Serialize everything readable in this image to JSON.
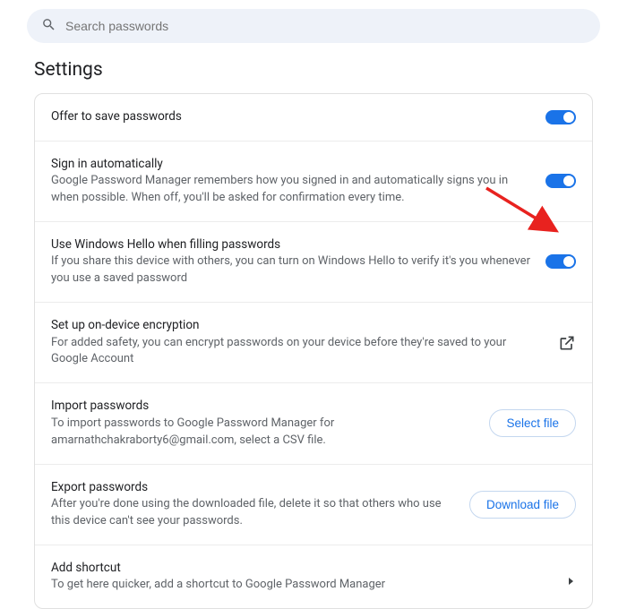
{
  "search": {
    "placeholder": "Search passwords"
  },
  "page_title": "Settings",
  "rows": {
    "offer_save": {
      "title": "Offer to save passwords"
    },
    "auto_signin": {
      "title": "Sign in automatically",
      "desc": "Google Password Manager remembers how you signed in and automatically signs you in when possible. When off, you'll be asked for confirmation every time."
    },
    "windows_hello": {
      "title": "Use Windows Hello when filling passwords",
      "desc": "If you share this device with others, you can turn on Windows Hello to verify it's you whenever you use a saved password"
    },
    "encryption": {
      "title": "Set up on-device encryption",
      "desc": "For added safety, you can encrypt passwords on your device before they're saved to your Google Account"
    },
    "import": {
      "title": "Import passwords",
      "desc": "To import passwords to Google Password Manager for amarnathchakraborty6@gmail.com, select a CSV file.",
      "button": "Select file"
    },
    "export": {
      "title": "Export passwords",
      "desc": "After you're done using the downloaded file, delete it so that others who use this device can't see your passwords.",
      "button": "Download file"
    },
    "shortcut": {
      "title": "Add shortcut",
      "desc": "To get here quicker, add a shortcut to Google Password Manager"
    }
  }
}
